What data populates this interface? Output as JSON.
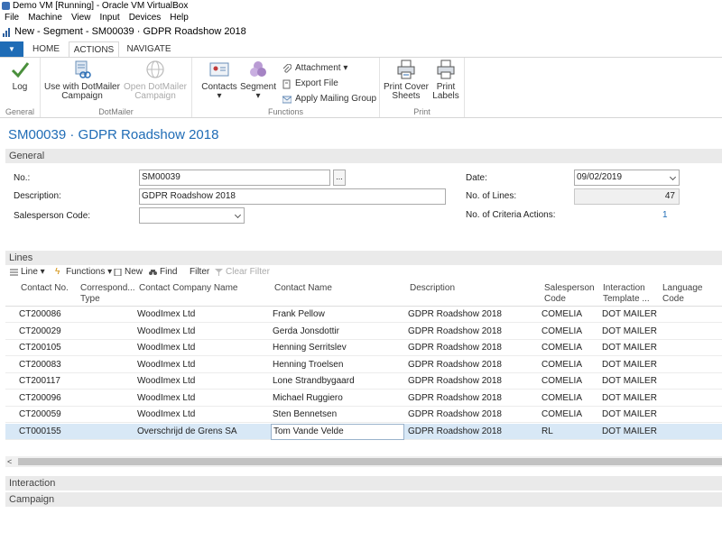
{
  "vbox": {
    "title": "Demo VM [Running] - Oracle VM VirtualBox",
    "menu": [
      "File",
      "Machine",
      "View",
      "Input",
      "Devices",
      "Help"
    ]
  },
  "window": {
    "title": "New - Segment - SM00039 · GDPR Roadshow 2018"
  },
  "ribbon": {
    "tabs": [
      "HOME",
      "ACTIONS",
      "NAVIGATE"
    ],
    "active_tab": "ACTIONS",
    "groups": {
      "general": {
        "label": "General",
        "log": "Log"
      },
      "dotmailer": {
        "label": "DotMailer",
        "use_campaign_1": "Use with DotMailer",
        "use_campaign_2": "Campaign",
        "open_campaign_1": "Open DotMailer",
        "open_campaign_2": "Campaign"
      },
      "functions": {
        "label": "Functions",
        "contacts": "Contacts",
        "segment": "Segment",
        "attachment": "Attachment",
        "export_file": "Export File",
        "apply_mailing_group": "Apply Mailing Group"
      },
      "print": {
        "label": "Print",
        "cover_1": "Print Cover",
        "cover_2": "Sheets",
        "labels_1": "Print",
        "labels_2": "Labels"
      }
    }
  },
  "page": {
    "heading": "SM00039 · GDPR Roadshow 2018"
  },
  "general": {
    "header": "General",
    "no_label": "No.:",
    "no_value": "SM00039",
    "assist": "...",
    "description_label": "Description:",
    "description_value": "GDPR Roadshow 2018",
    "salesperson_label": "Salesperson Code:",
    "salesperson_value": "",
    "date_label": "Date:",
    "date_value": "09/02/2019",
    "lines_count_label": "No. of Lines:",
    "lines_count_value": "47",
    "criteria_label": "No. of Criteria Actions:",
    "criteria_value": "1"
  },
  "lines": {
    "header": "Lines",
    "toolbar": {
      "line": "Line",
      "functions": "Functions",
      "new": "New",
      "find": "Find",
      "filter": "Filter",
      "clear_filter": "Clear Filter"
    },
    "columns": {
      "contact_no": "Contact No.",
      "corr_type_1": "Correspond...",
      "corr_type_2": "Type",
      "company": "Contact Company Name",
      "contact_name": "Contact Name",
      "description": "Description",
      "salesperson_1": "Salesperson",
      "salesperson_2": "Code",
      "template_1": "Interaction",
      "template_2": "Template ...",
      "language_1": "Language",
      "language_2": "Code"
    },
    "rows": [
      {
        "no": "CT200086",
        "company": "WoodImex Ltd",
        "name": "Frank Pellow",
        "desc": "GDPR Roadshow 2018",
        "sp": "COMELIA",
        "tmpl": "DOT MAILER"
      },
      {
        "no": "CT200029",
        "company": "WoodImex Ltd",
        "name": "Gerda Jonsdottir",
        "desc": "GDPR Roadshow 2018",
        "sp": "COMELIA",
        "tmpl": "DOT MAILER"
      },
      {
        "no": "CT200105",
        "company": "WoodImex Ltd",
        "name": "Henning Serritslev",
        "desc": "GDPR Roadshow 2018",
        "sp": "COMELIA",
        "tmpl": "DOT MAILER"
      },
      {
        "no": "CT200083",
        "company": "WoodImex Ltd",
        "name": "Henning Troelsen",
        "desc": "GDPR Roadshow 2018",
        "sp": "COMELIA",
        "tmpl": "DOT MAILER"
      },
      {
        "no": "CT200117",
        "company": "WoodImex Ltd",
        "name": "Lone Strandbygaard",
        "desc": "GDPR Roadshow 2018",
        "sp": "COMELIA",
        "tmpl": "DOT MAILER"
      },
      {
        "no": "CT200096",
        "company": "WoodImex Ltd",
        "name": "Michael Ruggiero",
        "desc": "GDPR Roadshow 2018",
        "sp": "COMELIA",
        "tmpl": "DOT MAILER"
      },
      {
        "no": "CT200059",
        "company": "WoodImex Ltd",
        "name": "Sten Bennetsen",
        "desc": "GDPR Roadshow 2018",
        "sp": "COMELIA",
        "tmpl": "DOT MAILER"
      },
      {
        "no": "CT000155",
        "company": "Overschrijd de Grens SA",
        "name": "Tom Vande Velde",
        "desc": "GDPR Roadshow 2018",
        "sp": "RL",
        "tmpl": "DOT MAILER"
      }
    ],
    "scroll_arrow": "<"
  },
  "sections": {
    "interaction": "Interaction",
    "campaign": "Campaign"
  },
  "colors": {
    "accent": "#1f6cb6",
    "selected_row": "#d8e8f6",
    "fasttab": "#eaeaea"
  }
}
